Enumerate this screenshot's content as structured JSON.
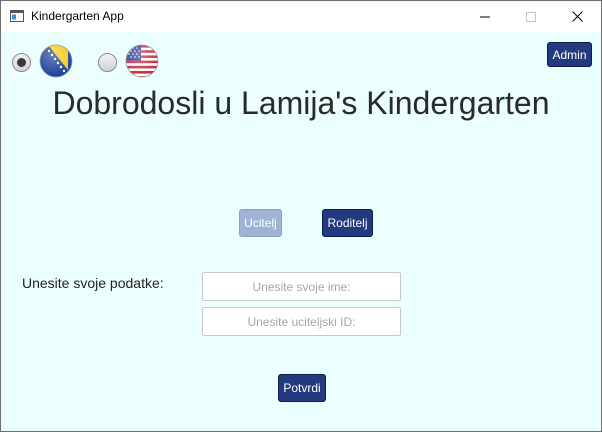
{
  "window": {
    "title": "Kindergarten App"
  },
  "language": {
    "options": [
      {
        "icon": "bosnia-flag-icon",
        "selected": true
      },
      {
        "icon": "usa-flag-icon",
        "selected": false
      }
    ]
  },
  "header": {
    "admin_label": "Admin",
    "welcome_text": "Dobrodosli u Lamija's Kindergarten"
  },
  "roles": {
    "teacher_label": "Ucitelj",
    "parent_label": "Roditelj"
  },
  "form": {
    "prompt_label": "Unesite svoje podatke:",
    "name_placeholder": "Unesite svoje ime:",
    "name_value": "",
    "id_placeholder": "Unesite uciteljski ID:",
    "id_value": "",
    "submit_label": "Potvrdi"
  },
  "colors": {
    "background": "#ebfffe",
    "primary_button": "#233a7e",
    "disabled_button": "#9eb3d6"
  }
}
